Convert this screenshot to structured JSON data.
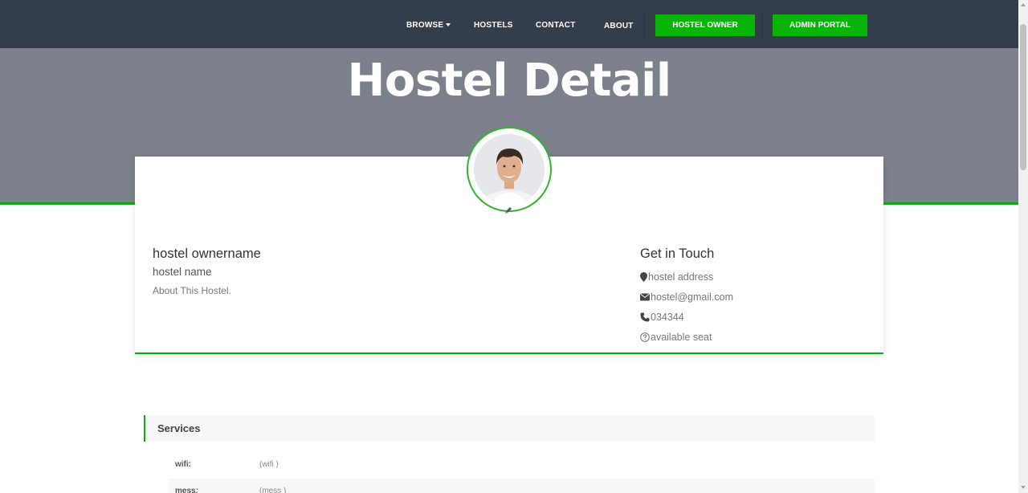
{
  "nav": {
    "browse": "BROWSE",
    "hostels": "HOSTELS",
    "contact": "CONTACT",
    "about": "ABOUT",
    "hostel_owner": "HOSTEL OWNER",
    "admin_portal": "ADMIN PORTAL"
  },
  "hero": {
    "title": "Hostel Detail"
  },
  "profile": {
    "owner_name": "hostel ownername",
    "hostel_name": "hostel name",
    "about": "About This Hostel."
  },
  "contact": {
    "title": "Get in Touch",
    "address": "hostel address",
    "email": "hostel@gmail.com",
    "phone": "034344",
    "seats": "available seat"
  },
  "services": {
    "title": "Services",
    "items": [
      {
        "label": "wifi:",
        "value": "(wifi )"
      },
      {
        "label": "mess:",
        "value": "(mess )"
      }
    ]
  },
  "colors": {
    "navbar": "#343e4a",
    "accent": "#07b407",
    "hero": "#7b808a"
  }
}
